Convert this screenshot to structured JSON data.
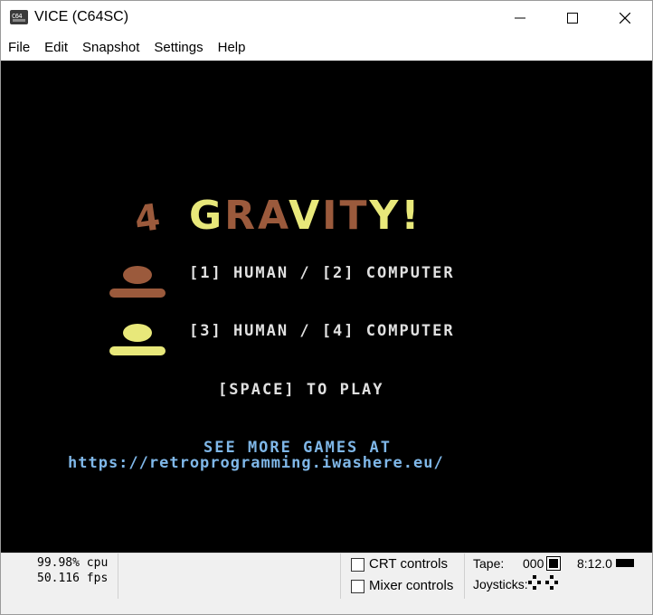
{
  "window": {
    "title": "VICE (C64SC)",
    "minimize_glyph": "—",
    "maximize_glyph": "☐",
    "close_glyph": "✕"
  },
  "menu": [
    "File",
    "Edit",
    "Snapshot",
    "Settings",
    "Help"
  ],
  "game": {
    "logo_number": "4",
    "logo_word": "GRAVITY!",
    "option1": "[1] HUMAN / [2] COMPUTER",
    "option2": "[3] HUMAN / [4] COMPUTER",
    "play": "[SPACE] TO PLAY",
    "see_more": "SEE MORE GAMES AT",
    "url": "https://retroprogramming.iwashere.eu/",
    "colors": {
      "brown": "#9b5a3c",
      "yellow": "#e8e87a",
      "text": "#e0e0e0",
      "blue": "#7fb7e8"
    }
  },
  "status": {
    "cpu": "99.98% cpu",
    "fps": "50.116 fps",
    "crt_controls": "CRT controls",
    "mixer_controls": "Mixer controls",
    "tape_label": "Tape:",
    "tape_counter": "000",
    "tape_time": "8:12.0",
    "joysticks_label": "Joysticks:"
  }
}
